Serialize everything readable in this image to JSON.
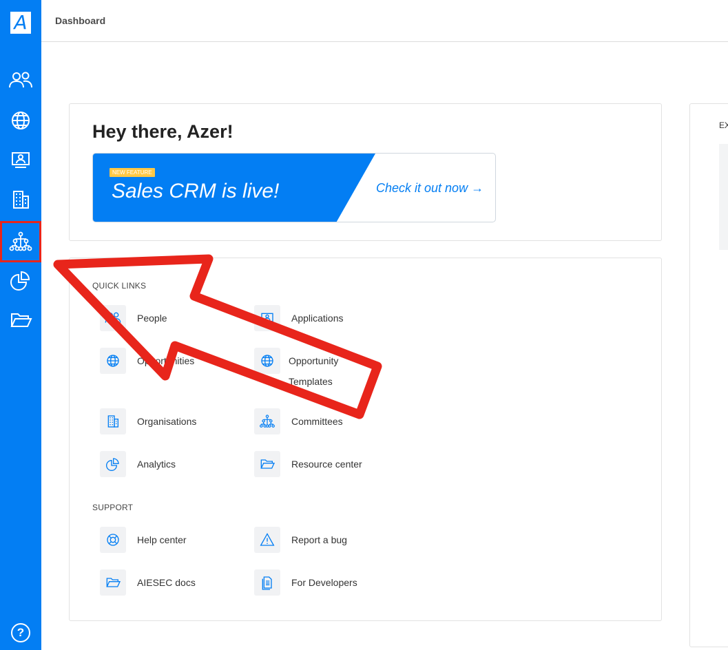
{
  "app": {
    "logo": "A",
    "page_title": "Dashboard"
  },
  "sidebar": {
    "items": [
      {
        "name": "people",
        "icon": "people-icon"
      },
      {
        "name": "opportunities",
        "icon": "globe-icon"
      },
      {
        "name": "applications",
        "icon": "monitor-user-icon"
      },
      {
        "name": "organisations",
        "icon": "building-icon"
      },
      {
        "name": "committees",
        "icon": "org-chart-icon",
        "active": true
      },
      {
        "name": "analytics",
        "icon": "pie-chart-icon"
      },
      {
        "name": "resource-center",
        "icon": "folder-open-icon"
      }
    ],
    "help_label": "?"
  },
  "hero": {
    "greeting": "Hey there, Azer!",
    "banner": {
      "badge": "NEW FEATURE",
      "title": "Sales CRM is live!",
      "cta": "Check it out now →"
    }
  },
  "quick_links": {
    "title": "QUICK LINKS",
    "items": [
      {
        "label": "People",
        "icon": "people-icon"
      },
      {
        "label": "Applications",
        "icon": "monitor-user-icon"
      },
      {
        "label": "Opportunities",
        "icon": "globe-icon"
      },
      {
        "label": "Opportunity Templates",
        "icon": "globe-icon"
      },
      {
        "label": "Organisations",
        "icon": "building-icon"
      },
      {
        "label": "Committees",
        "icon": "org-chart-icon"
      },
      {
        "label": "Analytics",
        "icon": "pie-chart-icon"
      },
      {
        "label": "Resource center",
        "icon": "folder-open-icon"
      }
    ]
  },
  "support": {
    "title": "SUPPORT",
    "items": [
      {
        "label": "Help center",
        "icon": "lifebuoy-icon"
      },
      {
        "label": "Report a bug",
        "icon": "warning-icon"
      },
      {
        "label": "AIESEC docs",
        "icon": "folder-open-icon"
      },
      {
        "label": "For Developers",
        "icon": "document-icon"
      }
    ]
  },
  "right_panel": {
    "title_fragment": "EX"
  },
  "colors": {
    "brand": "#037ef3",
    "annotation": "#e8251b",
    "badge": "#ffc845"
  }
}
